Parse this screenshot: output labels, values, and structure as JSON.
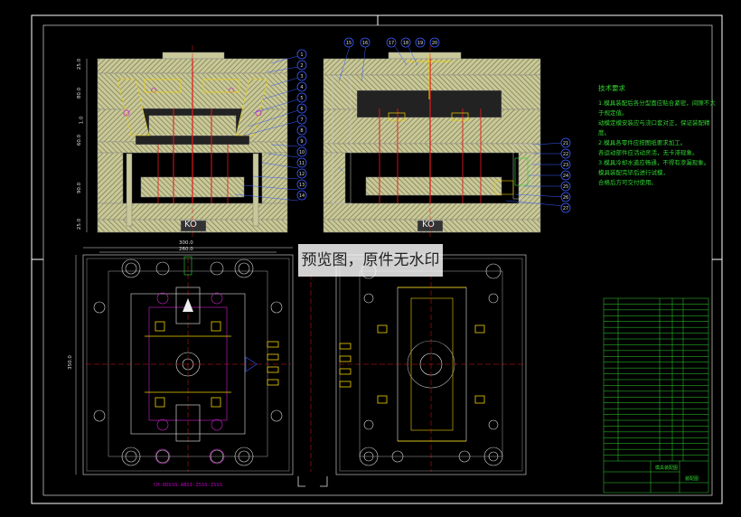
{
  "watermark": "预览图，原件无水印",
  "tech_notes": {
    "title": "技术要求",
    "lines": [
      "1.模具装配后各分型面应贴合紧密，间隙不大于规定值。",
      "动模定模安装应与浇口套对正，保证装配精度。",
      "2.模具各零件应按图纸要求加工。",
      "各运动部件应活动灵活，无卡滞现象。",
      "3.模具冷却水道应畅通，不得有渗漏现象。",
      "模具装配完毕后进行试模，",
      "合格后方可交付使用。"
    ]
  },
  "labels": {
    "ko_left": "KO",
    "ko_right": "KO",
    "part_number": "CH-DDSSS-ABSI-ZSSS-ZSSS"
  },
  "dimensions": {
    "width_top": "300.0",
    "width_inner": "260.0",
    "height_left": "350.0",
    "stack": [
      "25.0",
      "80.0",
      "1.0",
      "60.0",
      "90.0",
      "25.0"
    ]
  },
  "callouts": {
    "front_right": [
      "1",
      "2",
      "3",
      "4",
      "5",
      "6",
      "7",
      "8",
      "9",
      "10",
      "11",
      "12",
      "13",
      "14"
    ],
    "side_top": [
      "15",
      "16",
      "17",
      "18",
      "19",
      "20"
    ],
    "side_right": [
      "21",
      "22",
      "23",
      "24",
      "25",
      "26",
      "27"
    ]
  },
  "colors": {
    "background": "#000000",
    "frame": "#ffffff",
    "plate": "#c8c89a",
    "hatch": "#6d6d3a",
    "accent_red": "#e01818",
    "accent_green": "#31d331",
    "accent_magenta": "#d020d0",
    "accent_blue": "#3a5cff",
    "accent_yellow": "#f0d000"
  },
  "title_block": {
    "rows": 28,
    "drawing_name": "模具装配图",
    "label": "装配图"
  }
}
